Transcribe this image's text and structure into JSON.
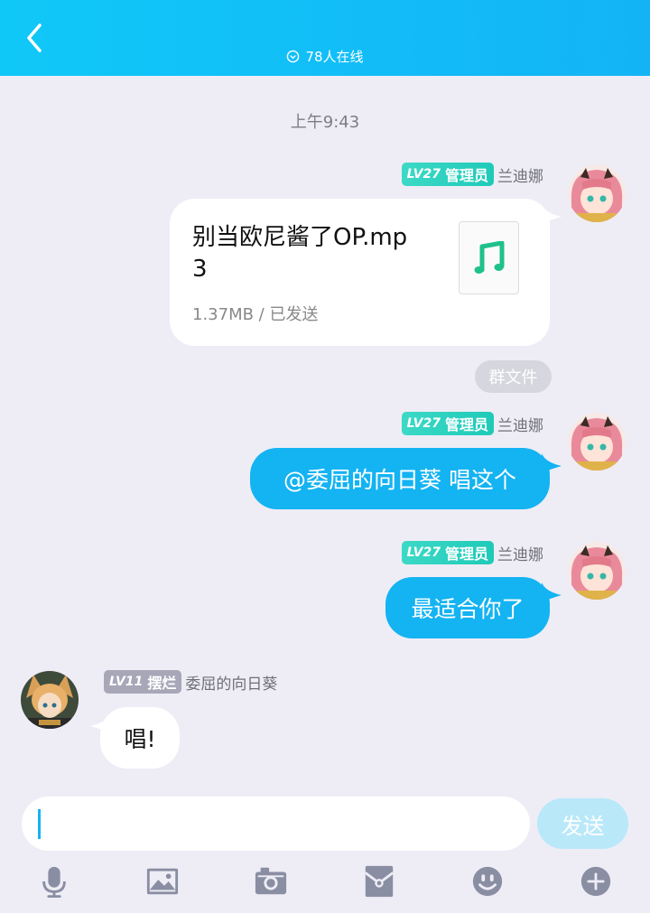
{
  "header": {
    "online_text": "78人在线"
  },
  "timestamp": "上午9:43",
  "messages": [
    {
      "sender": "兰迪娜",
      "level": "LV27",
      "role": "管理员",
      "file": {
        "name": "别当欧尼酱了OP.mp3",
        "name_line1": "别当欧尼酱了OP.mp",
        "name_line2": "3",
        "info": "1.37MB / 已发送"
      },
      "tag": "群文件"
    },
    {
      "sender": "兰迪娜",
      "level": "LV27",
      "role": "管理员",
      "text": "@委屈的向日葵 唱这个"
    },
    {
      "sender": "兰迪娜",
      "level": "LV27",
      "role": "管理员",
      "text": "最适合你了"
    },
    {
      "sender": "委屈的向日葵",
      "level": "LV11",
      "role": "摆烂",
      "text": "唱!"
    }
  ],
  "input": {
    "value": ""
  },
  "send_label": "发送",
  "toolbar": [
    "mic-icon",
    "image-icon",
    "camera-icon",
    "red-packet-icon",
    "emoji-icon",
    "plus-icon"
  ],
  "colors": {
    "header": "#13b4f6",
    "bubble_blue": "#14b3f2",
    "admin_badge": "#1fcab8",
    "member_badge": "#a7a7b8",
    "background": "#eeedf6"
  }
}
